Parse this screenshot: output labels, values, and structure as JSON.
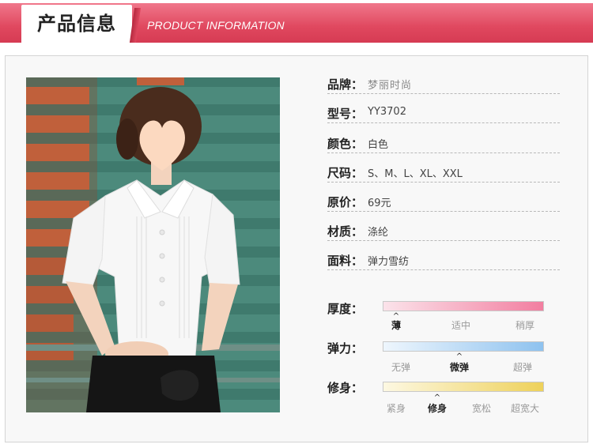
{
  "header": {
    "title": "产品信息",
    "subtitle": "PRODUCT INFORMATION"
  },
  "specs": [
    {
      "key": "品牌：",
      "value": "梦丽时尚"
    },
    {
      "key": "型号：",
      "value": "YY3702"
    },
    {
      "key": "颜色：",
      "value": "白色"
    },
    {
      "key": "尺码：",
      "value": "S、M、L、XL、XXL"
    },
    {
      "key": "原价：",
      "value": "69元"
    },
    {
      "key": "材质：",
      "value": "涤纶"
    },
    {
      "key": "面料：",
      "value": "弹力雪纺"
    }
  ],
  "scales": [
    {
      "label": "厚度：",
      "options": [
        "薄",
        "适中",
        "稍厚"
      ],
      "selected_index": 0,
      "gradient": [
        "#fbe3ea",
        "#f27ea0"
      ]
    },
    {
      "label": "弹力：",
      "options": [
        "无弹",
        "微弹",
        "超弹"
      ],
      "selected_index": 1,
      "gradient": [
        "#eef6fd",
        "#8ec2ef"
      ]
    },
    {
      "label": "修身：",
      "options": [
        "紧身",
        "修身",
        "宽松",
        "超宽大"
      ],
      "selected_index": 1,
      "gradient": [
        "#fdf8e2",
        "#eed15a"
      ]
    }
  ],
  "caret_glyph": "^",
  "colors": {
    "banner": "#e0485f",
    "wall_green": "#3f7a6d",
    "wall_orange": "#c0603b"
  }
}
